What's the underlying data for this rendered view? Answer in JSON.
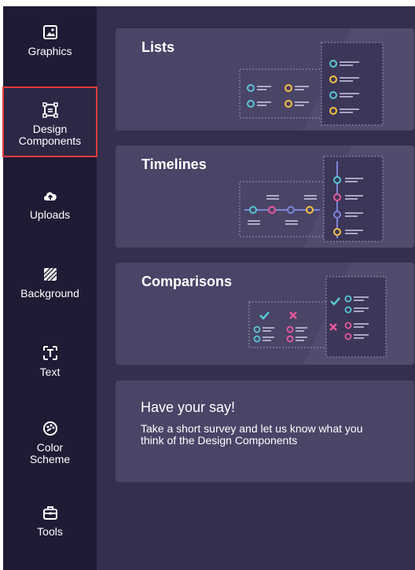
{
  "sidebar": {
    "items": [
      {
        "label": "Graphics",
        "icon": "image-icon",
        "active": false
      },
      {
        "label": "Design Components",
        "icon": "components-icon",
        "active": true
      },
      {
        "label": "Uploads",
        "icon": "cloud-upload-icon",
        "active": false
      },
      {
        "label": "Background",
        "icon": "background-pattern-icon",
        "active": false
      },
      {
        "label": "Text",
        "icon": "text-icon",
        "active": false
      },
      {
        "label": "Color Scheme",
        "icon": "palette-icon",
        "active": false
      },
      {
        "label": "Tools",
        "icon": "toolbox-icon",
        "active": false
      }
    ]
  },
  "panel": {
    "cards": [
      {
        "title": "Lists"
      },
      {
        "title": "Timelines"
      },
      {
        "title": "Comparisons"
      }
    ],
    "survey": {
      "title": "Have your say!",
      "body": "Take a short survey and let us know what you think of the Design Components"
    }
  },
  "colors": {
    "sidebar_bg": "#1f1b34",
    "panel_bg": "#342f4d",
    "card_bg": "#4a4467",
    "highlight": "#e03b3b",
    "teal": "#57c7d4",
    "yellow": "#f5c242",
    "pink": "#e85a9c",
    "purple": "#7a86d8"
  }
}
